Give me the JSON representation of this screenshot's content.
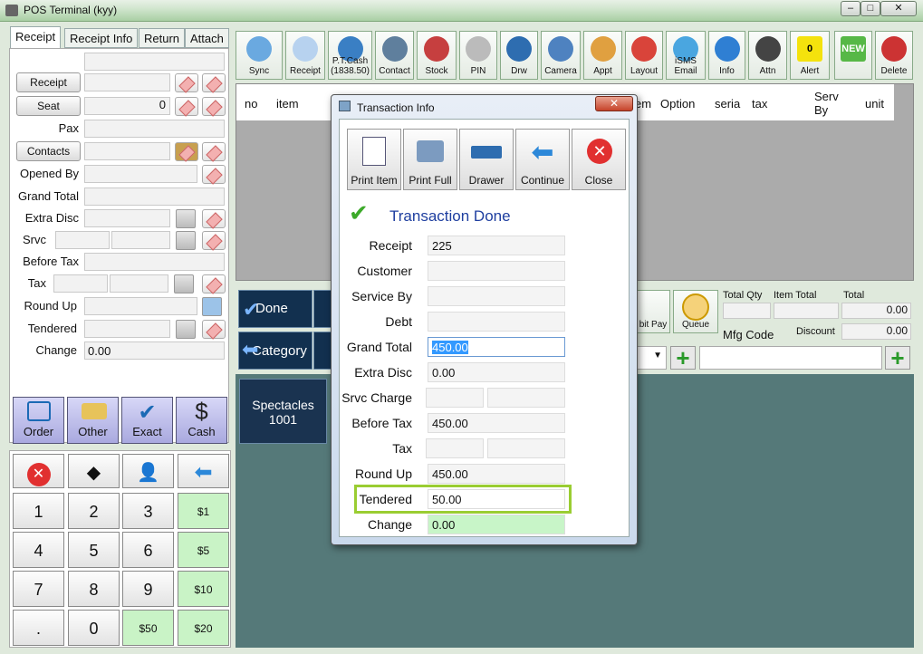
{
  "window": {
    "title": "POS Terminal (kyy)"
  },
  "tabs": [
    "Receipt",
    "Receipt Info",
    "Return",
    "Attach"
  ],
  "left_form": {
    "receipt_btn": "Receipt",
    "seat_btn": "Seat",
    "seat_value": "0",
    "contacts_btn": "Contacts",
    "labels": {
      "pax": "Pax",
      "opened_by": "Opened By",
      "grand_total": "Grand Total",
      "extra_disc": "Extra Disc",
      "srvc": "Srvc",
      "before_tax": "Before Tax",
      "tax": "Tax",
      "round_up": "Round Up",
      "tendered": "Tendered",
      "change": "Change"
    },
    "change_value": "0.00"
  },
  "pay_buttons": [
    "Order",
    "Other",
    "Exact",
    "Cash"
  ],
  "keypad": [
    "1",
    "2",
    "3",
    "$1",
    "4",
    "5",
    "6",
    "$5",
    "7",
    "8",
    "9",
    "$10",
    ".",
    "0",
    "$50",
    "$20"
  ],
  "toolbar": [
    {
      "label": "Sync",
      "icon": "sync-icon"
    },
    {
      "label": "Receipt",
      "icon": "receipt-icon"
    },
    {
      "label": "P.T.Cash\n(1838.50)",
      "icon": "key-icon"
    },
    {
      "label": "Contact",
      "icon": "person-icon"
    },
    {
      "label": "Stock",
      "icon": "house-icon"
    },
    {
      "label": "PIN",
      "icon": "phone-icon"
    },
    {
      "label": "Drw",
      "icon": "drawer-icon"
    },
    {
      "label": "Camera",
      "icon": "camera-icon"
    },
    {
      "label": "Appt",
      "icon": "pen-icon"
    },
    {
      "label": "Layout",
      "icon": "shop-icon"
    },
    {
      "label": "iSMS\nEmail",
      "icon": "email-icon"
    },
    {
      "label": "Info",
      "icon": "help-icon"
    },
    {
      "label": "Attn",
      "icon": "group-icon"
    },
    {
      "label": "Alert",
      "icon": "alert-icon",
      "badge": "0"
    },
    {
      "label": "",
      "icon": "new-icon",
      "badge": "NEW"
    },
    {
      "label": "Delete",
      "icon": "delete-icon"
    }
  ],
  "grid_headers": [
    "no",
    "item",
    "em",
    "Option",
    "seria",
    "tax",
    "Serv\nBy",
    "unit"
  ],
  "actions": {
    "done": "Done",
    "category": "Category",
    "debit_pay": "bit Pay",
    "queue": "Queue"
  },
  "summary": {
    "total_qty": "Total Qty",
    "item_total": "Item Total",
    "total": "Total",
    "total_value": "0.00",
    "mfg_code": "Mfg Code",
    "discount": "Discount",
    "discount_value": "0.00"
  },
  "product_tile": {
    "name": "Spectacles",
    "code": "1001"
  },
  "dialog": {
    "title": "Transaction Info",
    "toolbar": [
      "Print Item",
      "Print Full",
      "Drawer",
      "Continue",
      "Close"
    ],
    "status": "Transaction Done",
    "rows": [
      {
        "label": "Receipt",
        "value": "225"
      },
      {
        "label": "Customer",
        "value": ""
      },
      {
        "label": "Service By",
        "value": ""
      },
      {
        "label": "Debt",
        "value": ""
      },
      {
        "label": "Grand Total",
        "value": "450.00"
      },
      {
        "label": "Extra Disc",
        "value": "0.00"
      },
      {
        "label": "Srvc Charge",
        "value": ""
      },
      {
        "label": "Before Tax",
        "value": "450.00"
      },
      {
        "label": "Tax",
        "value": ""
      },
      {
        "label": "Round Up",
        "value": "450.00"
      },
      {
        "label": "Tendered",
        "value": "50.00"
      },
      {
        "label": "Change",
        "value": "0.00"
      }
    ]
  }
}
